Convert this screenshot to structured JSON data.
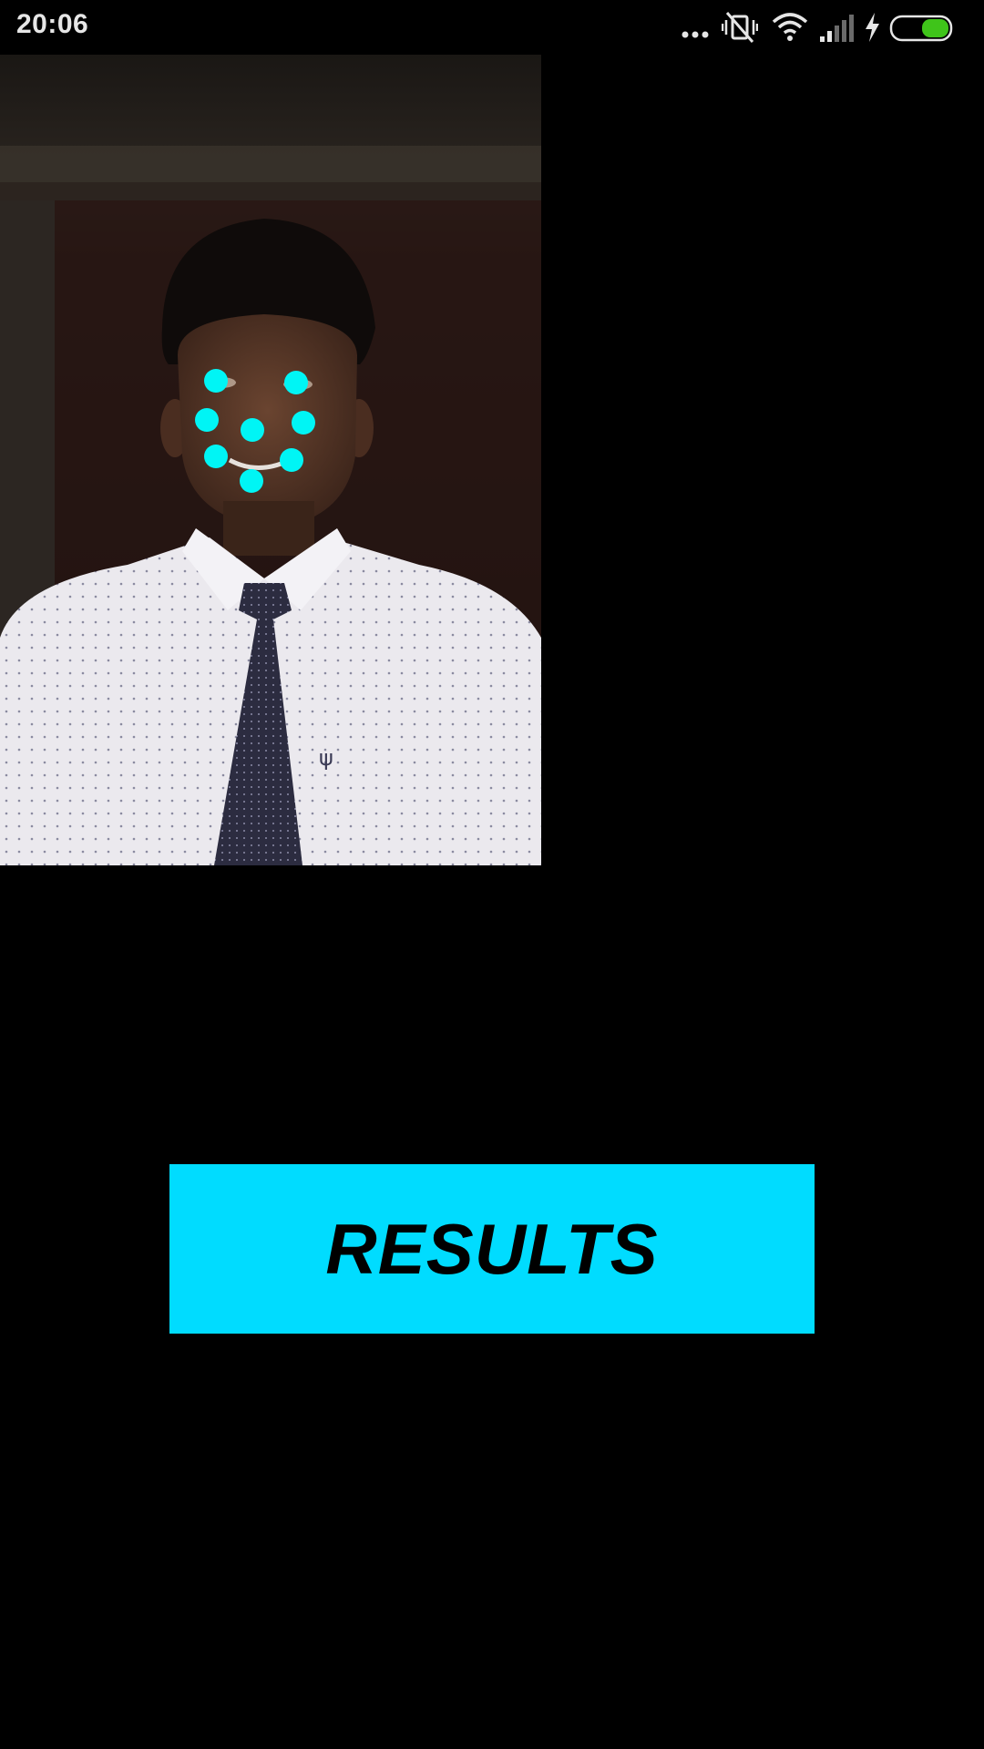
{
  "status_bar": {
    "time": "20:06",
    "icons": [
      "more-dots-icon",
      "vibrate-off-icon",
      "wifi-icon",
      "signal-icon",
      "charging-icon",
      "battery-icon"
    ],
    "battery_color": "#3fc41a"
  },
  "photo": {
    "description_icon": "portrait-photo",
    "landmark_color": "#00f5f5"
  },
  "results_button": {
    "label": "RESULTS",
    "background": "#00dcff"
  }
}
